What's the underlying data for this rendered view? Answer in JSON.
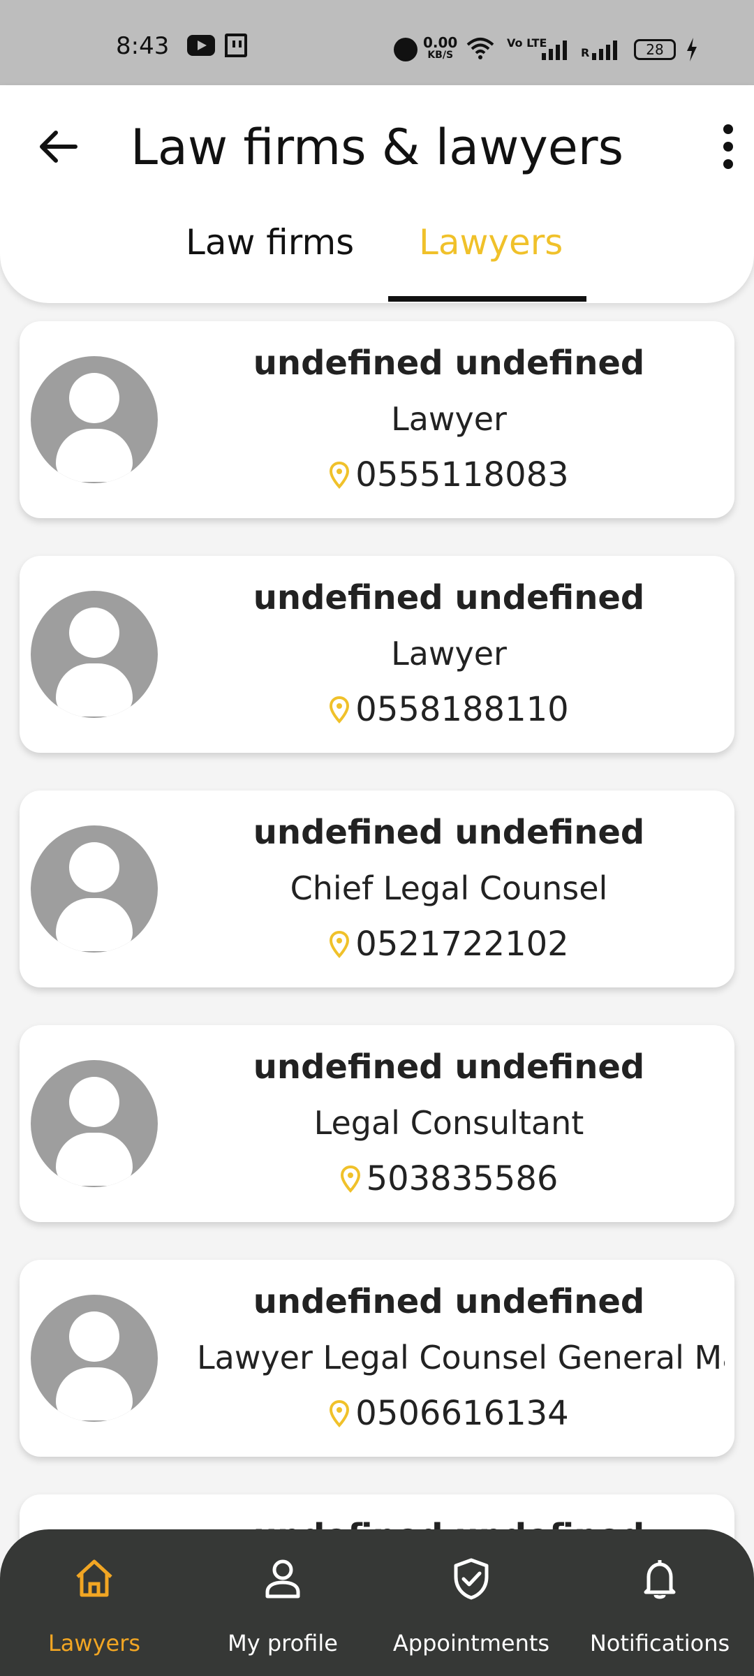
{
  "status_bar": {
    "time": "8:43",
    "speed_value": "0.00",
    "speed_unit": "KB/S",
    "volte": "Vo LTE",
    "roaming": "R",
    "battery": "28",
    "icons": [
      "youtube-icon",
      "twitch-icon",
      "alarm-icon",
      "wifi-icon",
      "signal-icon",
      "battery-icon",
      "charging-icon"
    ]
  },
  "header": {
    "title": "Law firms & lawyers",
    "back_icon": "arrow-left-icon",
    "menu_icon": "more-vertical-icon",
    "tabs": [
      {
        "label": "Law firms",
        "active": false
      },
      {
        "label": "Lawyers",
        "active": true
      }
    ]
  },
  "colors": {
    "accent": "#f0c12a",
    "nav_active": "#f2a623",
    "nav_background": "#363836",
    "avatar": "#9e9e9e"
  },
  "lawyers": [
    {
      "name": "undefined undefined",
      "role": "Lawyer",
      "phone": "0555118083"
    },
    {
      "name": "undefined undefined",
      "role": "Lawyer",
      "phone": "0558188110"
    },
    {
      "name": "undefined undefined",
      "role": "Chief Legal Counsel",
      "phone": "0521722102"
    },
    {
      "name": "undefined undefined",
      "role": "Legal Consultant",
      "phone": "503835586"
    },
    {
      "name": "undefined undefined",
      "role": "Lawyer Legal Counsel General Ma",
      "phone": "0506616134"
    },
    {
      "name": "undefined undefined",
      "role": "",
      "phone": ""
    }
  ],
  "bottom_nav": [
    {
      "label": "Lawyers",
      "icon": "home-icon",
      "active": true
    },
    {
      "label": "My profile",
      "icon": "person-icon",
      "active": false
    },
    {
      "label": "Appointments",
      "icon": "shield-check-icon",
      "active": false
    },
    {
      "label": "Notifications",
      "icon": "bell-icon",
      "active": false
    }
  ]
}
